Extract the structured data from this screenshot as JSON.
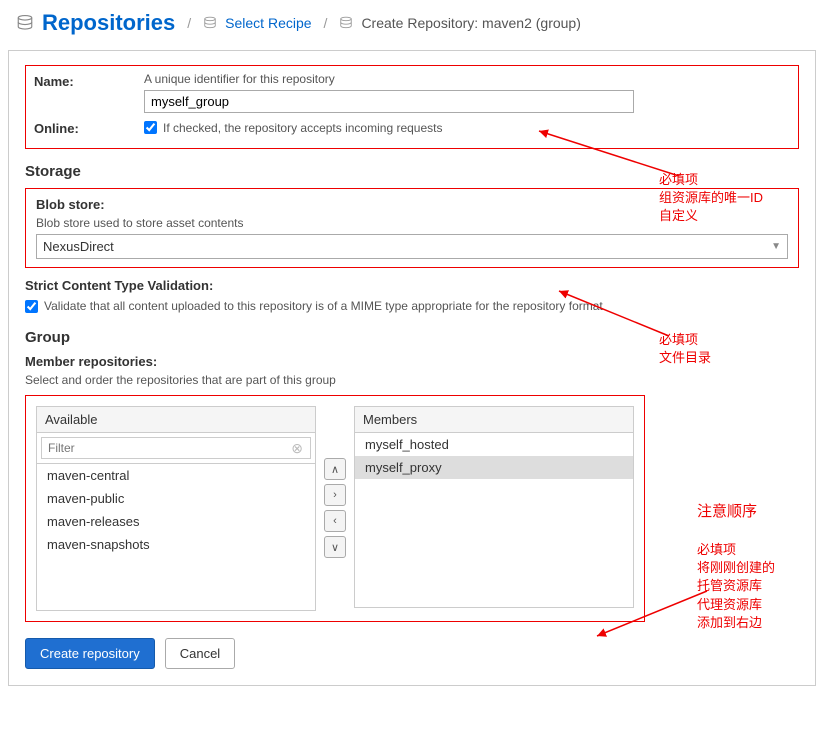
{
  "breadcrumb": {
    "title": "Repositories",
    "link": "Select Recipe",
    "current": "Create Repository: maven2 (group)"
  },
  "form": {
    "name_label": "Name:",
    "name_hint": "A unique identifier for this repository",
    "name_value": "myself_group",
    "online_label": "Online:",
    "online_desc": "If checked, the repository accepts incoming requests"
  },
  "storage": {
    "heading": "Storage",
    "blob_label": "Blob store:",
    "blob_hint": "Blob store used to store asset contents",
    "blob_value": "NexusDirect",
    "strict_label": "Strict Content Type Validation:",
    "strict_desc": "Validate that all content uploaded to this repository is of a MIME type appropriate for the repository format"
  },
  "group": {
    "heading": "Group",
    "member_label": "Member repositories:",
    "member_hint": "Select and order the repositories that are part of this group",
    "available_header": "Available",
    "members_header": "Members",
    "filter_placeholder": "Filter",
    "available_items": [
      "maven-central",
      "maven-public",
      "maven-releases",
      "maven-snapshots"
    ],
    "member_items": [
      "myself_hosted",
      "myself_proxy"
    ],
    "selected_member": "myself_proxy"
  },
  "buttons": {
    "create": "Create repository",
    "cancel": "Cancel"
  },
  "annotations": {
    "a1": "必填项\n组资源库的唯一ID\n自定义",
    "a2": "必填项\n文件目录",
    "a3": "注意顺序",
    "a4": "必填项\n将刚刚创建的\n托管资源库\n代理资源库\n添加到右边"
  }
}
